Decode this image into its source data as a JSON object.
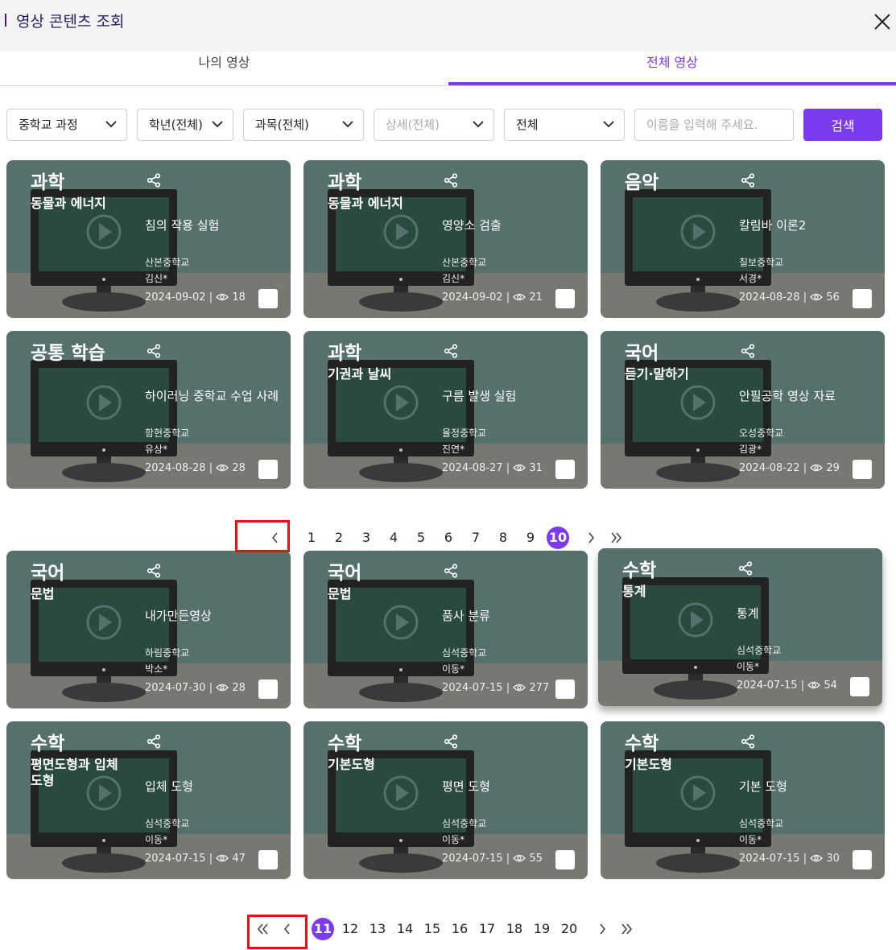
{
  "header": {
    "title": "영상 콘텐츠 조회"
  },
  "tabs": [
    {
      "label": "나의 영상",
      "active": false
    },
    {
      "label": "전체 영상",
      "active": true
    }
  ],
  "filters": {
    "course": "중학교 과정",
    "grade": "학년(전체)",
    "subject": "과목(전체)",
    "detail": "상세(전체)",
    "scope": "전체",
    "search_placeholder": "이름을 입력해 주세요.",
    "search_button": "검색"
  },
  "colors": {
    "accent": "#7c3aed",
    "highlight": "#e01414",
    "card_top": "#56706c",
    "card_bottom": "#767871"
  },
  "icons": {
    "close": "close-icon",
    "share": "share-icon",
    "views": "eye-icon",
    "play": "play-icon"
  },
  "list1": [
    {
      "subject": "과학",
      "unit": "동물과 에너지",
      "title": "침의 작용 실험",
      "school": "산본중학교",
      "author": "김신*",
      "date": "2024-09-02",
      "views": "18"
    },
    {
      "subject": "과학",
      "unit": "동물과 에너지",
      "title": "영양소 검출",
      "school": "산본중학교",
      "author": "김신*",
      "date": "2024-09-02",
      "views": "21"
    },
    {
      "subject": "음악",
      "unit": "",
      "title": "칼림바 이론2",
      "school": "칠보중학교",
      "author": "서경*",
      "date": "2024-08-28",
      "views": "56"
    },
    {
      "subject": "공통 학습",
      "unit": "",
      "title": "하이러닝 중학교 수업 사례",
      "school": "함현중학교",
      "author": "유상*",
      "date": "2024-08-28",
      "views": "28"
    },
    {
      "subject": "과학",
      "unit": "기권과 날씨",
      "title": "구름 발생 실험",
      "school": "율정중학교",
      "author": "진연*",
      "date": "2024-08-27",
      "views": "31"
    },
    {
      "subject": "국어",
      "unit": "듣기·말하기",
      "title": "안필공학 영상 자료",
      "school": "오성중학교",
      "author": "김광*",
      "date": "2024-08-22",
      "views": "29"
    }
  ],
  "pagination1": {
    "pages": [
      "1",
      "2",
      "3",
      "4",
      "5",
      "6",
      "7",
      "8",
      "9",
      "10"
    ],
    "current": "10"
  },
  "list2": [
    {
      "subject": "국어",
      "unit": "문법",
      "title": "내가만든영상",
      "school": "하림중학교",
      "author": "박소*",
      "date": "2024-07-30",
      "views": "28"
    },
    {
      "subject": "국어",
      "unit": "문법",
      "title": "품사 분류",
      "school": "심석중학교",
      "author": "이동*",
      "date": "2024-07-15",
      "views": "277"
    },
    {
      "subject": "수학",
      "unit": "통계",
      "title": "통계",
      "school": "심석중학교",
      "author": "이동*",
      "date": "2024-07-15",
      "views": "54"
    },
    {
      "subject": "수학",
      "unit": "평면도형과 입체도형",
      "title": "입체 도형",
      "school": "심석중학교",
      "author": "이동*",
      "date": "2024-07-15",
      "views": "47"
    },
    {
      "subject": "수학",
      "unit": "기본도형",
      "title": "평면 도형",
      "school": "심석중학교",
      "author": "이동*",
      "date": "2024-07-15",
      "views": "55"
    },
    {
      "subject": "수학",
      "unit": "기본도형",
      "title": "기본 도형",
      "school": "심석중학교",
      "author": "이동*",
      "date": "2024-07-15",
      "views": "30"
    }
  ],
  "pagination2": {
    "pages": [
      "11",
      "12",
      "13",
      "14",
      "15",
      "16",
      "17",
      "18",
      "19",
      "20"
    ],
    "current": "11"
  }
}
